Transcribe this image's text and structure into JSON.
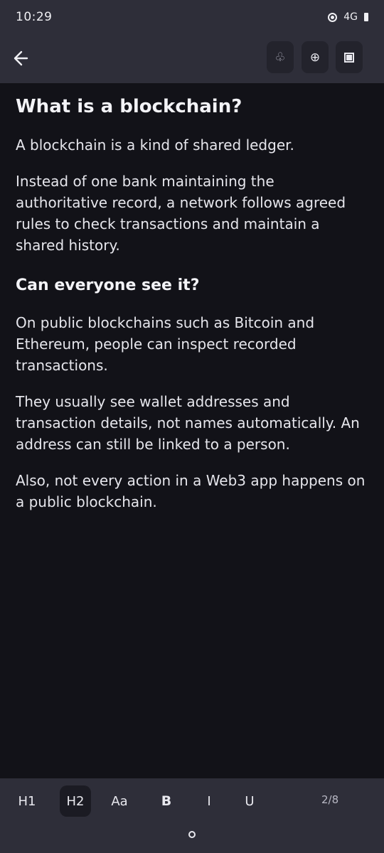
{
  "status": {
    "time": "10:29",
    "network": "4G"
  },
  "app_bar": {
    "back_icon": "arrow-left-icon",
    "buttons": [
      {
        "icon": "club-icon",
        "glyph": "♧"
      },
      {
        "icon": "circled-plus-icon",
        "glyph": "⊕"
      },
      {
        "icon": "square-icon",
        "glyph": ""
      }
    ]
  },
  "article": {
    "title": "What is a blockchain?",
    "p1": "A blockchain is a kind of shared ledger.",
    "p2": "Instead of one bank maintaining the authoritative record, a network follows agreed rules to check transactions and maintain a shared history.",
    "heading2": "Can everyone see it?",
    "p3": "On public blockchains such as Bitcoin and Ethereum, people can inspect recorded transactions.",
    "p4": "They usually see wallet addresses and transaction details, not names automatically. An address can still be linked to a person.",
    "p5": "Also, not every action in a Web3 app happens on a public blockchain."
  },
  "format_bar": {
    "h1": "H1",
    "h2": "H2",
    "aa": "Aa",
    "bold": "B",
    "italic": "I",
    "underline": "U",
    "page": "2/8",
    "active": "H2"
  }
}
